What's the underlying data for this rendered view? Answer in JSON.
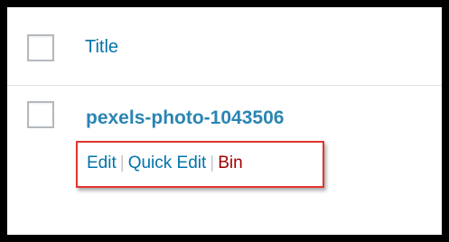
{
  "table": {
    "header": {
      "title_label": "Title"
    },
    "rows": [
      {
        "title": "pexels-photo-1043506",
        "actions": {
          "edit": "Edit",
          "quick_edit": "Quick Edit",
          "bin": "Bin",
          "separator": "|"
        }
      }
    ]
  },
  "colors": {
    "link": "#0073aa",
    "trash": "#a00000",
    "highlight_border": "#e3342f"
  }
}
